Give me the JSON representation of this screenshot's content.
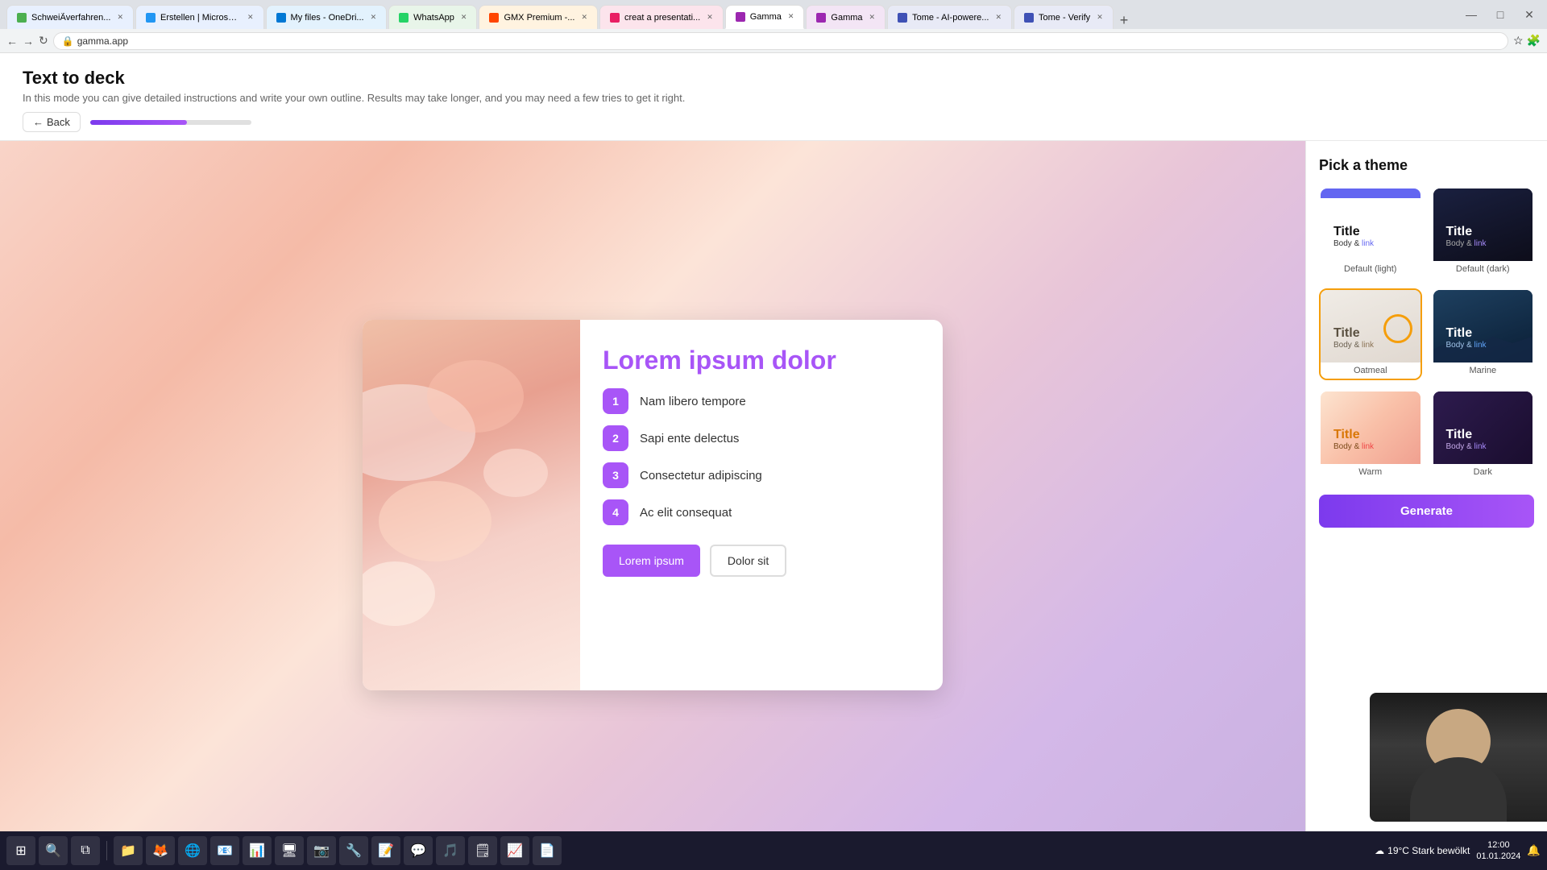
{
  "browser": {
    "tabs": [
      {
        "id": "schweiss",
        "label": "SchweiÃverfahren...",
        "favicon_color": "#4CAF50",
        "active": false
      },
      {
        "id": "erstellen",
        "label": "Erstellen | Microsof...",
        "favicon_color": "#2196F3",
        "active": false
      },
      {
        "id": "onedrive",
        "label": "My files - OneDri...",
        "favicon_color": "#0078D4",
        "active": false
      },
      {
        "id": "whatsapp",
        "label": "WhatsApp",
        "favicon_color": "#25D366",
        "active": false
      },
      {
        "id": "gmx",
        "label": "GMX Premium -...",
        "favicon_color": "#FF4500",
        "active": false
      },
      {
        "id": "create-pres",
        "label": "creat a presentati...",
        "favicon_color": "#E91E63",
        "active": false
      },
      {
        "id": "gamma",
        "label": "Gamma",
        "favicon_color": "#9C27B0",
        "active": true
      },
      {
        "id": "gamma2",
        "label": "Gamma",
        "favicon_color": "#9C27B0",
        "active": false
      },
      {
        "id": "tome",
        "label": "Tome - AI-powere...",
        "favicon_color": "#3F51B5",
        "active": false
      },
      {
        "id": "tome-verify",
        "label": "Tome - Verify",
        "favicon_color": "#3F51B5",
        "active": false
      }
    ],
    "address": "gamma.app"
  },
  "header": {
    "title": "Text to deck",
    "subtitle": "In this mode you can give detailed instructions and write your own outline. Results may take longer, and you may need a few tries to get it right.",
    "back_label": "Back",
    "progress": 60
  },
  "slide": {
    "title": "Lorem ipsum dolor",
    "items": [
      {
        "number": "1",
        "text": "Nam libero tempore"
      },
      {
        "number": "2",
        "text": "Sapi ente delectus"
      },
      {
        "number": "3",
        "text": "Consectetur adipiscing"
      },
      {
        "number": "4",
        "text": "Ac elit consequat"
      }
    ],
    "btn_primary": "Lorem ipsum",
    "btn_secondary": "Dolor sit"
  },
  "theme_panel": {
    "title": "Pick a theme",
    "themes": [
      {
        "id": "default-light",
        "label": "Default (light)",
        "title_text": "Title",
        "body_text": "Body & ",
        "link_text": "link",
        "class": "theme-default-light"
      },
      {
        "id": "default-dark",
        "label": "Default (dark)",
        "title_text": "Title",
        "body_text": "Body & ",
        "link_text": "link",
        "class": "theme-default-dark"
      },
      {
        "id": "oatmeal",
        "label": "Oatmeal",
        "title_text": "Title",
        "body_text": "Body & ",
        "link_text": "link",
        "class": "theme-oatmeal"
      },
      {
        "id": "marine",
        "label": "Marine",
        "title_text": "Title",
        "body_text": "Body & ",
        "link_text": "link",
        "class": "theme-marine"
      },
      {
        "id": "warm",
        "label": "Warm",
        "title_text": "Title",
        "body_text": "Body & ",
        "link_text": "link",
        "class": "theme-warm"
      },
      {
        "id": "dark-gradient",
        "label": "Dark",
        "title_text": "Title",
        "body_text": "Body & ",
        "link_text": "link",
        "class": "theme-dark-gradient"
      }
    ],
    "generate_btn": "Generate"
  },
  "taskbar": {
    "weather": "19°C  Stark bewölkt"
  }
}
